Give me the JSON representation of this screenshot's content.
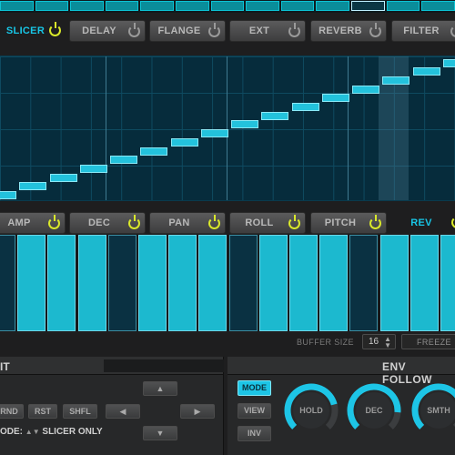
{
  "step_strip": {
    "count": 13,
    "active_index": 10
  },
  "fx_row": [
    {
      "id": "slicer",
      "label": "SLICER",
      "on": true,
      "plain": true
    },
    {
      "id": "delay",
      "label": "DELAY",
      "on": false
    },
    {
      "id": "flange",
      "label": "FLANGE",
      "on": false
    },
    {
      "id": "ext",
      "label": "EXT",
      "on": false
    },
    {
      "id": "reverb",
      "label": "REVERB",
      "on": false
    },
    {
      "id": "filter",
      "label": "FILTER",
      "on": false
    }
  ],
  "mod_row": [
    {
      "id": "amp",
      "label": "AMP",
      "on": true
    },
    {
      "id": "dec",
      "label": "DEC",
      "on": true
    },
    {
      "id": "pan",
      "label": "PAN",
      "on": true
    },
    {
      "id": "roll",
      "label": "ROLL",
      "on": true
    },
    {
      "id": "pitch",
      "label": "PITCH",
      "on": true
    },
    {
      "id": "rev",
      "label": "REV",
      "on": true,
      "plain": true
    }
  ],
  "slice_steps": [
    0,
    1,
    2,
    3,
    4,
    5,
    6,
    7,
    8,
    9,
    10,
    11,
    12,
    13,
    14,
    15
  ],
  "level_bars": [
    {
      "full": false
    },
    {
      "full": true
    },
    {
      "full": true
    },
    {
      "full": true
    },
    {
      "full": false
    },
    {
      "full": true
    },
    {
      "full": true
    },
    {
      "full": true
    },
    {
      "full": false
    },
    {
      "full": true
    },
    {
      "full": true
    },
    {
      "full": true
    },
    {
      "full": false
    },
    {
      "full": true
    },
    {
      "full": true
    },
    {
      "full": true
    }
  ],
  "buffer": {
    "label": "BUFFER SIZE",
    "value": "16",
    "freeze_label": "FREEZE"
  },
  "edit_panel": {
    "title": "IT",
    "buttons": {
      "rnd": "RND",
      "rst": "RST",
      "shfl": "SHFL"
    },
    "arrows": {
      "up": "▲",
      "down": "▼",
      "left": "◀",
      "right": "▶"
    },
    "mode_prefix": "ODE:",
    "mode_value": "SLICER ONLY"
  },
  "env_panel": {
    "title": "ENV FOLLOW",
    "buttons": {
      "mode": "MODE",
      "view": "VIEW",
      "inv": "INV"
    },
    "knobs": [
      {
        "id": "hold",
        "label": "HOLD",
        "value": 0.78
      },
      {
        "id": "dec",
        "label": "DEC",
        "value": 0.85
      },
      {
        "id": "smth",
        "label": "SMTH",
        "value": 0.8
      }
    ]
  },
  "colors": {
    "accent": "#1dc5e6",
    "power_on": "#d9e82a"
  }
}
